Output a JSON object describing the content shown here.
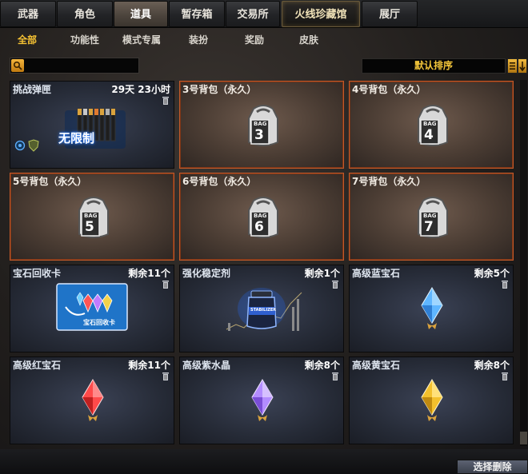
{
  "top_tabs": [
    {
      "label": "武器"
    },
    {
      "label": "角色"
    },
    {
      "label": "道具"
    },
    {
      "label": "暂存箱"
    },
    {
      "label": "交易所"
    },
    {
      "label": "火线珍藏馆"
    },
    {
      "label": "展厅"
    }
  ],
  "active_top_tab": "道具",
  "sub_tabs": [
    {
      "label": "全部"
    },
    {
      "label": "功能性"
    },
    {
      "label": "模式专属"
    },
    {
      "label": "装扮"
    },
    {
      "label": "奖励"
    },
    {
      "label": "皮肤"
    }
  ],
  "active_sub_tab": "全部",
  "search": {
    "value": "",
    "placeholder": ""
  },
  "sort": {
    "label": "默认排序"
  },
  "items": [
    {
      "name": "挑战弹匣",
      "status": "29天 23小时",
      "icon": "ammo-clip-icon",
      "badge_text": "无限制"
    },
    {
      "name": "3号背包（永久）",
      "status": "",
      "icon": "backpack-icon",
      "bag_label": "BAG",
      "bag_number": "3"
    },
    {
      "name": "4号背包（永久）",
      "status": "",
      "icon": "backpack-icon",
      "bag_label": "BAG",
      "bag_number": "4"
    },
    {
      "name": "5号背包（永久）",
      "status": "",
      "icon": "backpack-icon",
      "bag_label": "BAG",
      "bag_number": "5"
    },
    {
      "name": "6号背包（永久）",
      "status": "",
      "icon": "backpack-icon",
      "bag_label": "BAG",
      "bag_number": "6"
    },
    {
      "name": "7号背包（永久）",
      "status": "",
      "icon": "backpack-icon",
      "bag_label": "BAG",
      "bag_number": "7"
    },
    {
      "name": "宝石回收卡",
      "status": "剩余11个",
      "icon": "gem-recycle-card-icon",
      "card_text": "宝石回收卡"
    },
    {
      "name": "强化稳定剂",
      "status": "剩余1个",
      "icon": "stabilizer-bottle-icon",
      "bottle_text": "STABILIZER"
    },
    {
      "name": "高级蓝宝石",
      "status": "剩余5个",
      "icon": "blue-gem-icon",
      "color": "#5fb6ff"
    },
    {
      "name": "高级红宝石",
      "status": "剩余11个",
      "icon": "red-gem-icon",
      "color": "#ff4a4a"
    },
    {
      "name": "高级紫水晶",
      "status": "剩余8个",
      "icon": "purple-gem-icon",
      "color": "#b38cff"
    },
    {
      "name": "高级黄宝石",
      "status": "剩余8个",
      "icon": "yellow-gem-icon",
      "color": "#f3c02d"
    }
  ],
  "delete_button": {
    "label": "选择删除"
  },
  "colors": {
    "accent": "#f6c233",
    "highlight_border": "#c25a2a"
  }
}
